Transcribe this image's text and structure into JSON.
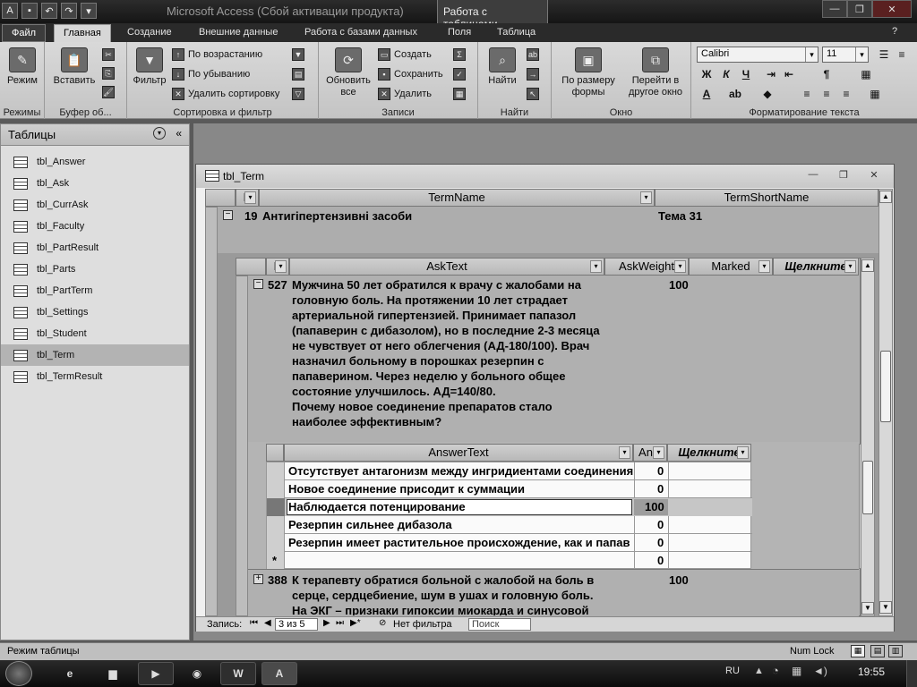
{
  "app": {
    "title": "Microsoft Access (Сбой активации продукта)",
    "context_tab": "Работа с таблицами"
  },
  "ribbon_tabs": [
    "Файл",
    "Главная",
    "Создание",
    "Внешние данные",
    "Работа с базами данных",
    "Поля",
    "Таблица"
  ],
  "ribbon": {
    "views": {
      "mode_label": "Режим",
      "group": "Режимы"
    },
    "clipboard": {
      "paste_label": "Вставить",
      "group": "Буфер об..."
    },
    "sort_filter": {
      "filter_label": "Фильтр",
      "asc_label": "По возрастанию",
      "desc_label": "По убыванию",
      "remove_sort_label": "Удалить сортировку",
      "group": "Сортировка и фильтр"
    },
    "records": {
      "refresh_label": "Обновить все",
      "create_label": "Создать",
      "save_label": "Сохранить",
      "delete_label": "Удалить",
      "group": "Записи"
    },
    "find": {
      "find_label": "Найти",
      "group": "Найти"
    },
    "window": {
      "fit_label": "По размеру формы",
      "switch_label": "Перейти в другое окно",
      "group": "Окно"
    },
    "text_format": {
      "font": "Calibri",
      "size": "11",
      "bold": "Ж",
      "italic": "К",
      "underline": "Ч",
      "group": "Форматирование текста"
    }
  },
  "nav": {
    "header": "Таблицы",
    "items": [
      "tbl_Answer",
      "tbl_Ask",
      "tbl_CurrAsk",
      "tbl_Faculty",
      "tbl_PartResult",
      "tbl_Parts",
      "tbl_PartTerm",
      "tbl_Settings",
      "tbl_Student",
      "tbl_Term",
      "tbl_TermResult"
    ],
    "selected": "tbl_Term"
  },
  "doc": {
    "title": "tbl_Term",
    "term_headers": {
      "k": "K",
      "name": "TermName",
      "short": "TermShortName"
    },
    "term_row": {
      "id": "19",
      "name": "Антигіпертензивні засоби",
      "short": "Тема 31"
    },
    "ask_headers": {
      "k": "K",
      "text": "AskText",
      "weight": "AskWeight",
      "marked": "Marked",
      "click": "Щелкните"
    },
    "ask_row": {
      "id": "527",
      "lines": [
        "Мужчина 50 лет обратился к врачу с жалобами на",
        "головную боль. На протяжении 10 лет страдает",
        "артериальной гипертензией. Принимает папазол",
        "(папаверин с дибазолом), но в последние 2-3 месяца",
        "не чувствует от него облегчения (АД-180/100). Врач",
        "назначил больному в порошках резерпин с",
        "папаверином. Через неделю у больного общее",
        "состояние улучшилось. АД=140/80.",
        "Почему новое соединение препаратов стало",
        "наиболее эффективным?"
      ],
      "weight": "100"
    },
    "answer_headers": {
      "text": "AnswerText",
      "an": "An",
      "click": "Щелкните"
    },
    "answers": [
      {
        "text": "Отсутствует антагонизм между ингридиентами соединения",
        "value": "0"
      },
      {
        "text": "Новое соединение присодит к суммации",
        "value": "0"
      },
      {
        "text": "Наблюдается потенцирование",
        "value": "100"
      },
      {
        "text": "Резерпин сильнее дибазола",
        "value": "0"
      },
      {
        "text": "Резерпин имеет растительное происхождение, как и папав",
        "value": "0"
      }
    ],
    "new_row": {
      "marker": "*",
      "value": "0"
    },
    "ask_row2": {
      "id": "388",
      "lines": [
        "К терапевту обратися больной с жалобой на боль в",
        "серце, сердцебиение, шум в ушах и головную боль.",
        "На ЭКГ – признаки гипоксии миокарда и синусовой"
      ],
      "weight": "100"
    },
    "record_nav": {
      "label": "Запись:",
      "position": "3 из 5",
      "filter": "Нет фильтра",
      "search": "Поиск"
    }
  },
  "status": {
    "left": "Режим таблицы",
    "numlock": "Num Lock"
  },
  "taskbar": {
    "lang": "RU",
    "time": "19:55"
  }
}
